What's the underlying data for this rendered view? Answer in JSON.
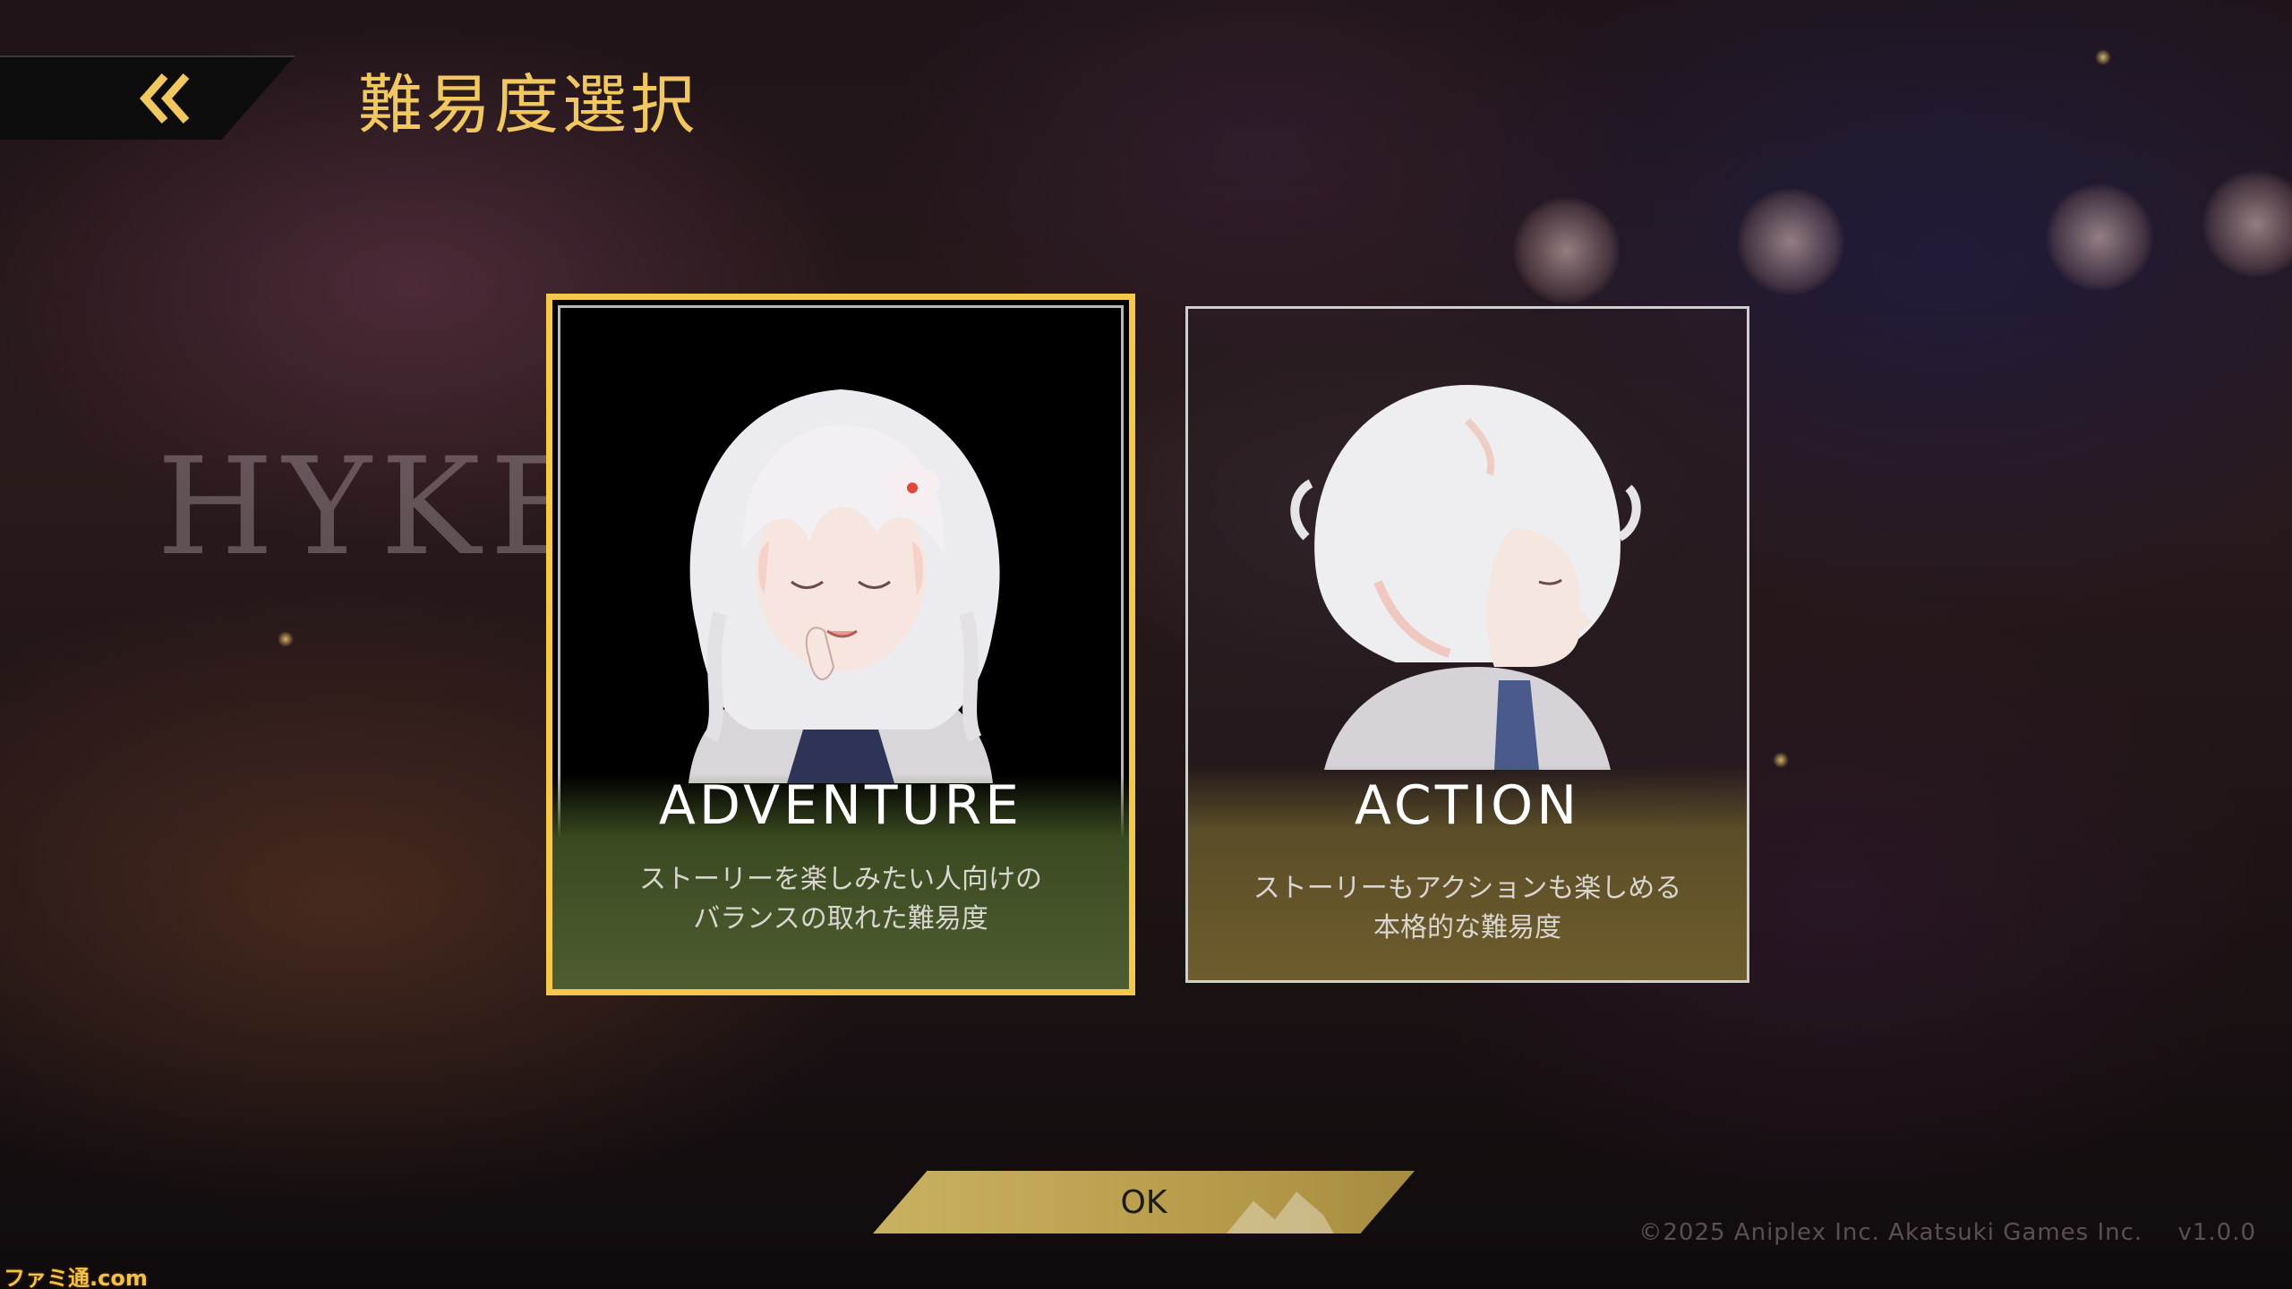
{
  "header": {
    "back_icon": "double-chevron-left-icon",
    "title": "難易度選択"
  },
  "background": {
    "logo_text": "HYKE"
  },
  "cards": [
    {
      "id": "adventure",
      "selected": true,
      "title": "ADVENTURE",
      "description": [
        "ストーリーを楽しみたい人向けの",
        "バランスの取れた難易度"
      ],
      "accent_color": "#f5c84b",
      "band_color": "#4f5c31"
    },
    {
      "id": "action",
      "selected": false,
      "title": "ACTION",
      "description": [
        "ストーリーもアクションも楽しめる",
        "本格的な難易度"
      ],
      "band_color": "#6e5c2c"
    }
  ],
  "ok_button": {
    "label": "OK",
    "color": "#c9b162"
  },
  "footer": {
    "copyright": "©2025 Aniplex Inc. Akatsuki Games Inc.",
    "version": "v1.0.0",
    "watermark": "ファミ通.com"
  }
}
